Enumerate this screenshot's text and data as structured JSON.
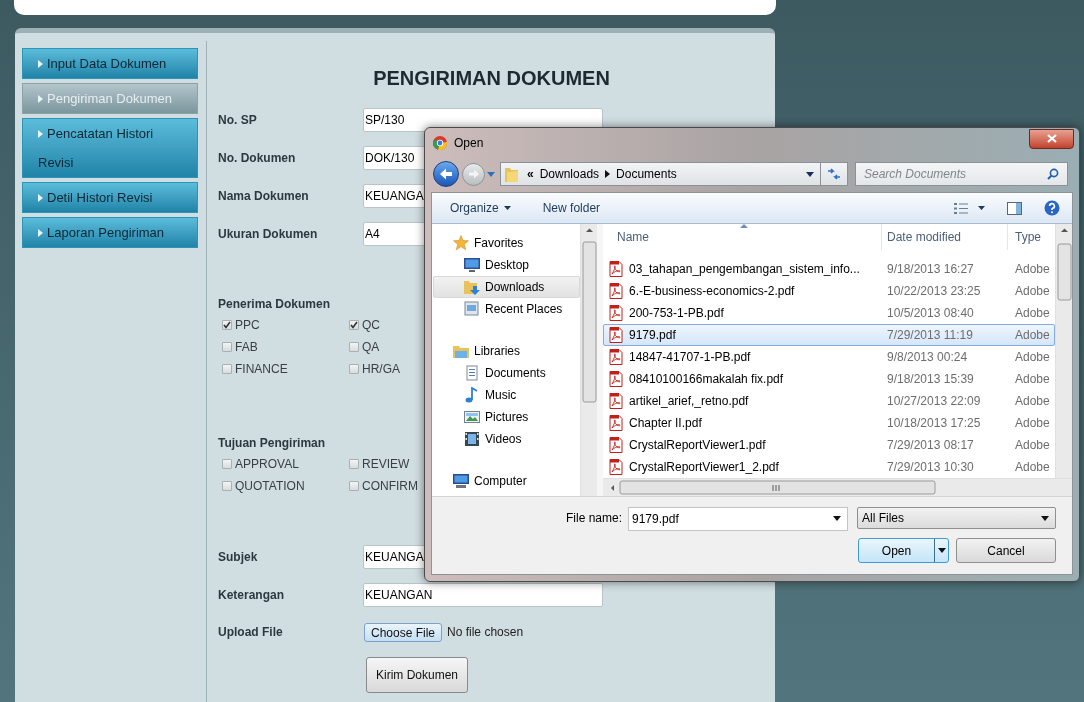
{
  "sidebar": {
    "items": [
      {
        "label": "Input Data Dokumen",
        "selected": false
      },
      {
        "label": "Pengiriman Dokumen",
        "selected": true
      },
      {
        "label": "Pencatatan Histori Revisi",
        "selected": false
      },
      {
        "label": "Detil Histori Revisi",
        "selected": false
      },
      {
        "label": "Laporan Pengiriman",
        "selected": false
      }
    ]
  },
  "form": {
    "title": "PENGIRIMAN DOKUMEN",
    "fields": [
      {
        "label": "No. SP",
        "value": "SP/130"
      },
      {
        "label": "No. Dokumen",
        "value": "DOK/130"
      },
      {
        "label": "Nama Dokumen",
        "value": "KEUANGA"
      },
      {
        "label": "Ukuran Dokumen",
        "value": "A4"
      }
    ],
    "checkbox_groups": [
      {
        "label": "Penerima Dokumen",
        "options": [
          {
            "label": "PPC",
            "checked": true
          },
          {
            "label": "QC",
            "checked": true
          },
          {
            "label": "FAB",
            "checked": false
          },
          {
            "label": "QA",
            "checked": false
          },
          {
            "label": "FINANCE",
            "checked": false
          },
          {
            "label": "HR/GA",
            "checked": false
          }
        ]
      },
      {
        "label": "Tujuan Pengiriman",
        "options": [
          {
            "label": "APPROVAL",
            "checked": false
          },
          {
            "label": "REVIEW",
            "checked": false
          },
          {
            "label": "QUOTATION",
            "checked": false
          },
          {
            "label": "CONFIRM",
            "checked": false
          }
        ]
      }
    ],
    "extra_fields": [
      {
        "label": "Subjek",
        "value": "KEUANGA"
      },
      {
        "label": "Keterangan",
        "value": "KEUANGAN"
      }
    ],
    "upload": {
      "label": "Upload File",
      "button": "Choose File",
      "status": "No file chosen"
    },
    "submit": "Kirim Dokumen"
  },
  "dialog": {
    "title": "Open",
    "address": {
      "overflow": "«",
      "path": [
        "Downloads",
        "Documents"
      ]
    },
    "search": {
      "placeholder": "Search Documents"
    },
    "toolbar": {
      "organize": "Organize",
      "new_folder": "New folder"
    },
    "nav": [
      {
        "label": "Favorites",
        "selected": false,
        "children": [
          {
            "label": "Desktop",
            "selected": false
          },
          {
            "label": "Downloads",
            "selected": true
          },
          {
            "label": "Recent Places",
            "selected": false
          }
        ]
      },
      {
        "label": "Libraries",
        "selected": false,
        "children": [
          {
            "label": "Documents",
            "selected": false
          },
          {
            "label": "Music",
            "selected": false
          },
          {
            "label": "Pictures",
            "selected": false
          },
          {
            "label": "Videos",
            "selected": false
          }
        ]
      },
      {
        "label": "Computer",
        "selected": false
      }
    ],
    "columns": [
      "Name",
      "Date modified",
      "Type"
    ],
    "rows": [
      {
        "name": "03_tahapan_pengembangan_sistem_info...",
        "date": "9/18/2013 16:27",
        "type": "Adobe",
        "selected": false
      },
      {
        "name": "6.-E-business-economics-2.pdf",
        "date": "10/22/2013 23:25",
        "type": "Adobe",
        "selected": false
      },
      {
        "name": "200-753-1-PB.pdf",
        "date": "10/5/2013 08:40",
        "type": "Adobe",
        "selected": false
      },
      {
        "name": "9179.pdf",
        "date": "7/29/2013 11:19",
        "type": "Adobe",
        "selected": true
      },
      {
        "name": "14847-41707-1-PB.pdf",
        "date": "9/8/2013 00:24",
        "type": "Adobe",
        "selected": false
      },
      {
        "name": "08410100166makalah fix.pdf",
        "date": "9/18/2013 15:39",
        "type": "Adobe",
        "selected": false
      },
      {
        "name": "artikel_arief,_retno.pdf",
        "date": "10/27/2013 22:09",
        "type": "Adobe",
        "selected": false
      },
      {
        "name": "Chapter II.pdf",
        "date": "10/18/2013 17:25",
        "type": "Adobe",
        "selected": false
      },
      {
        "name": "CrystalReportViewer1.pdf",
        "date": "7/29/2013 08:17",
        "type": "Adobe",
        "selected": false
      },
      {
        "name": "CrystalReportViewer1_2.pdf",
        "date": "7/29/2013 10:30",
        "type": "Adobe",
        "selected": false
      }
    ],
    "file_name": {
      "label": "File name:",
      "value": "9179.pdf"
    },
    "filter": "All Files",
    "buttons": [
      "Open",
      "Cancel"
    ]
  }
}
